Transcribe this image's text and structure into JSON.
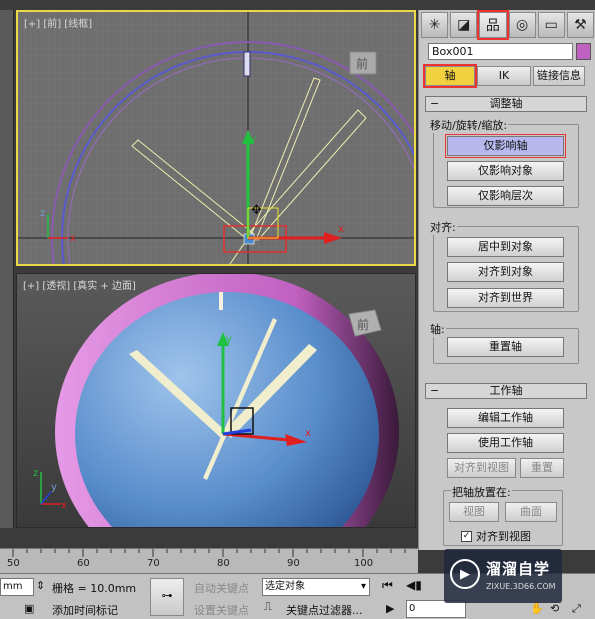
{
  "viewports": {
    "front_label": "[+] [前] [线框]",
    "persp_label": "[+] [透视] [真实 + 边面]",
    "front_viewcube": "前",
    "persp_viewcube": "前"
  },
  "panel": {
    "tabs": [
      "create-icon",
      "modify-icon",
      "hierarchy-icon",
      "motion-icon",
      "display-icon",
      "utilities-icon"
    ],
    "tab_glyphs": [
      "✳",
      "◪",
      "品",
      "◎",
      "▭",
      "⚒"
    ],
    "object_name": "Box001",
    "object_color": "#c060c0",
    "subtabs": [
      "轴",
      "IK",
      "链接信息"
    ],
    "adjust_pivot": {
      "title": "调整轴",
      "group_move": "移动/旋转/缩放:",
      "btn_pivot_only": "仅影响轴",
      "btn_object_only": "仅影响对象",
      "btn_hierarchy_only": "仅影响层次",
      "group_align": "对齐:",
      "btn_center": "居中到对象",
      "btn_align_object": "对齐到对象",
      "btn_align_world": "对齐到世界",
      "group_pivot": "轴:",
      "btn_reset_pivot": "重置轴"
    },
    "working_pivot": {
      "title": "工作轴",
      "btn_edit": "编辑工作轴",
      "btn_use": "使用工作轴",
      "btn_align_view": "对齐到视图",
      "btn_reset": "重置",
      "group_place": "把轴放置在:",
      "btn_view": "视图",
      "btn_surface": "曲面",
      "check_align_view": "对齐到视图"
    }
  },
  "timeline": {
    "ticks": [
      "50",
      "60",
      "70",
      "80",
      "90",
      "100"
    ]
  },
  "bottom": {
    "unit_field": "mm",
    "grid_label": "栅格 = 10.0mm",
    "auto_key": "自动关键点",
    "set_key": "设置关键点",
    "selection_dropdown": "选定对象",
    "key_filters": "关键点过滤器...",
    "add_time_tag": "添加时间标记",
    "frame_field": "0"
  },
  "watermark": {
    "title": "溜溜自学",
    "url": "ZIXUE.3D66.COM"
  }
}
